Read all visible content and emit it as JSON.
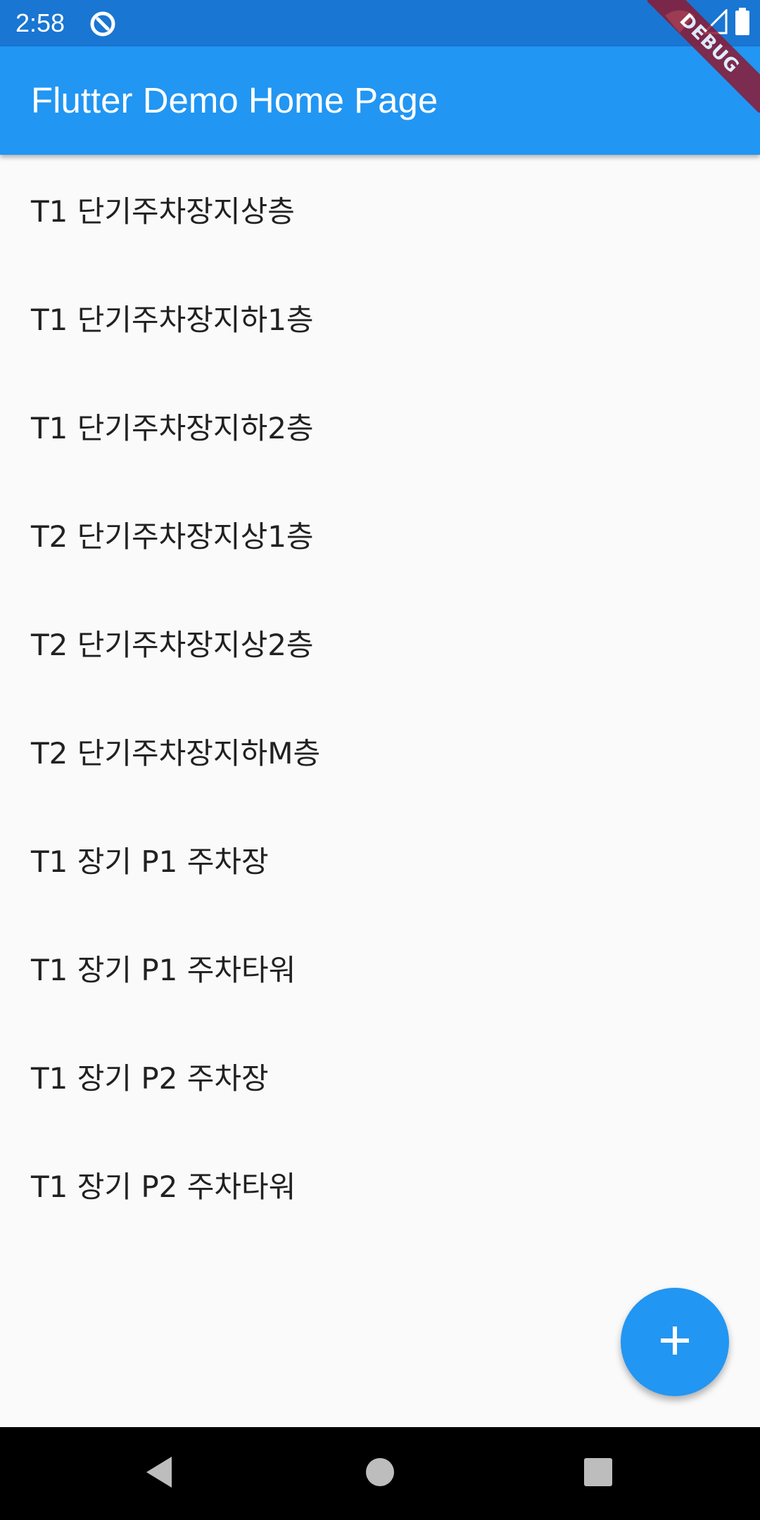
{
  "status_bar": {
    "time": "2:58",
    "icons": [
      "app-notification-icon",
      "wifi-icon",
      "cell-signal-icon",
      "battery-icon"
    ]
  },
  "app_bar": {
    "title": "Flutter Demo Home Page"
  },
  "debug_banner": {
    "label": "DEBUG"
  },
  "list": {
    "items": [
      "T1 단기주차장지상층",
      "T1 단기주차장지하1층",
      "T1 단기주차장지하2층",
      "T2 단기주차장지상1층",
      "T2 단기주차장지상2층",
      "T2 단기주차장지하M층",
      "T1 장기 P1 주차장",
      "T1 장기 P1 주차타워",
      "T1 장기 P2 주차장",
      "T1 장기 P2 주차타워"
    ]
  },
  "fab": {
    "icon": "add-icon"
  },
  "nav_bar": {
    "icons": [
      "back-icon",
      "home-icon",
      "recents-icon"
    ]
  },
  "colors": {
    "status_bar": "#1976d2",
    "app_bar": "#2196f3",
    "fab": "#2196f3",
    "background": "#fafafa",
    "debug_banner": "#8b1a33"
  }
}
